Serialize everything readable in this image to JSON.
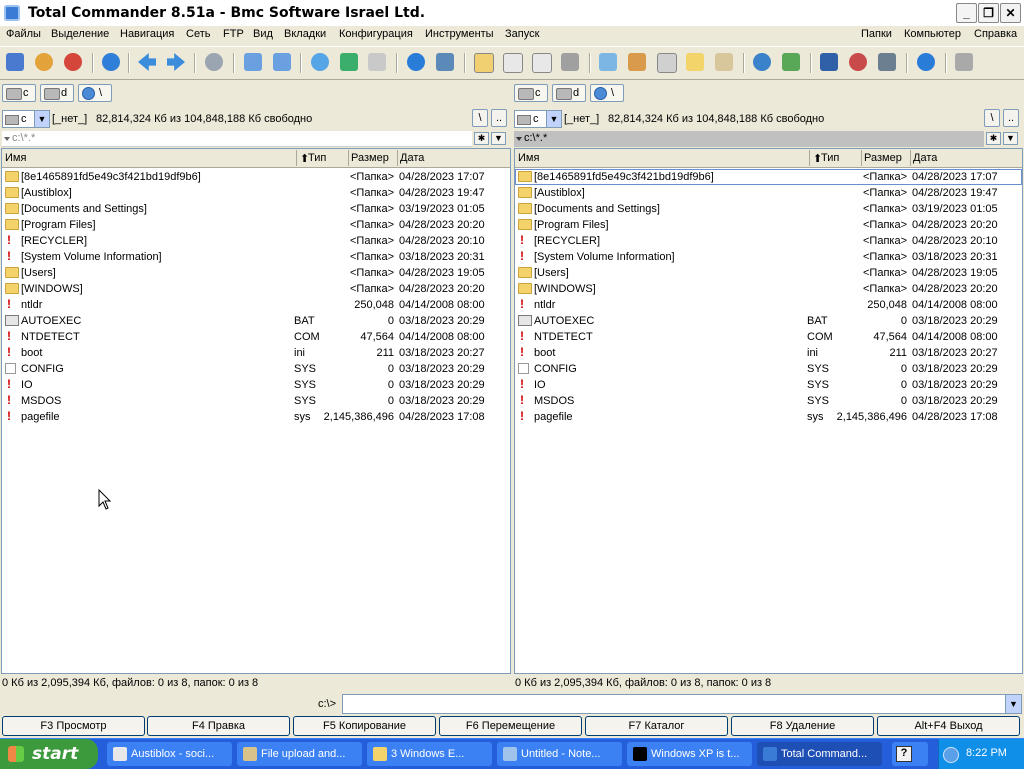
{
  "window": {
    "title": "Total Commander 8.51a - Bmc Software Israel Ltd."
  },
  "menu": {
    "left": [
      "Файлы",
      "Выделение",
      "Навигация",
      "Сеть",
      "FTP",
      "Вид",
      "Вкладки",
      "Конфигурация",
      "Инструменты",
      "Запуск"
    ],
    "right": [
      "Папки",
      "Компьютер",
      "Справка"
    ]
  },
  "drives": [
    {
      "label": "c"
    },
    {
      "label": "d"
    },
    {
      "label": "\\"
    }
  ],
  "left_panel": {
    "drive_combo": "c",
    "volume": "[_нет_]",
    "free": "82,814,324 Кб из 104,848,188 Кб свободно",
    "btn_root": "\\",
    "btn_up": "..",
    "path": "c:\\*.*",
    "headers": {
      "name": "Имя",
      "ext": "Тип",
      "size": "Размер",
      "date": "Дата"
    },
    "status": "0 Кб из 2,095,394 Кб, файлов: 0 из 8, папок: 0 из 8"
  },
  "right_panel": {
    "drive_combo": "c",
    "volume": "[_нет_]",
    "free": "82,814,324 Кб из 104,848,188 Кб свободно",
    "btn_root": "\\",
    "btn_up": "..",
    "path": "c:\\*.*",
    "headers": {
      "name": "Имя",
      "ext": "Тип",
      "size": "Размер",
      "date": "Дата"
    },
    "status": "0 Кб из 2,095,394 Кб, файлов: 0 из 8, папок: 0 из 8"
  },
  "files": [
    {
      "icon": "folder",
      "name": "[8e1465891fd5e49c3f421bd19df9b6]",
      "ext": "",
      "size": "<Папка>",
      "date": "04/28/2023 17:07"
    },
    {
      "icon": "folder",
      "name": "[Austiblox]",
      "ext": "",
      "size": "<Папка>",
      "date": "04/28/2023 19:47"
    },
    {
      "icon": "folder",
      "name": "[Documents and Settings]",
      "ext": "",
      "size": "<Папка>",
      "date": "03/19/2023 01:05"
    },
    {
      "icon": "folder",
      "name": "[Program Files]",
      "ext": "",
      "size": "<Папка>",
      "date": "04/28/2023 20:20"
    },
    {
      "icon": "hidden",
      "name": "[RECYCLER]",
      "ext": "",
      "size": "<Папка>",
      "date": "04/28/2023 20:10"
    },
    {
      "icon": "hidden",
      "name": "[System Volume Information]",
      "ext": "",
      "size": "<Папка>",
      "date": "03/18/2023 20:31"
    },
    {
      "icon": "folder",
      "name": "[Users]",
      "ext": "",
      "size": "<Папка>",
      "date": "04/28/2023 19:05"
    },
    {
      "icon": "folder",
      "name": "[WINDOWS]",
      "ext": "",
      "size": "<Папка>",
      "date": "04/28/2023 20:20"
    },
    {
      "icon": "hidden",
      "name": "ntldr",
      "ext": "",
      "size": "250,048",
      "date": "04/14/2008 08:00"
    },
    {
      "icon": "exe",
      "name": "AUTOEXEC",
      "ext": "BAT",
      "size": "0",
      "date": "03/18/2023 20:29"
    },
    {
      "icon": "hidden",
      "name": "NTDETECT",
      "ext": "COM",
      "size": "47,564",
      "date": "04/14/2008 08:00"
    },
    {
      "icon": "hidden",
      "name": "boot",
      "ext": "ini",
      "size": "211",
      "date": "03/18/2023 20:27"
    },
    {
      "icon": "file",
      "name": "CONFIG",
      "ext": "SYS",
      "size": "0",
      "date": "03/18/2023 20:29"
    },
    {
      "icon": "hidden",
      "name": "IO",
      "ext": "SYS",
      "size": "0",
      "date": "03/18/2023 20:29"
    },
    {
      "icon": "hidden",
      "name": "MSDOS",
      "ext": "SYS",
      "size": "0",
      "date": "03/18/2023 20:29"
    },
    {
      "icon": "hidden",
      "name": "pagefile",
      "ext": "sys",
      "size": "2,145,386,496",
      "date": "04/28/2023 17:08"
    }
  ],
  "cmdline": {
    "label": "c:\\>",
    "value": ""
  },
  "fkeys": [
    "F3 Просмотр",
    "F4 Правка",
    "F5 Копирование",
    "F6 Перемещение",
    "F7 Каталог",
    "F8 Удаление",
    "Alt+F4 Выход"
  ],
  "taskbar": {
    "start": "start",
    "tasks": [
      "Austiblox - soci...",
      "File upload and...",
      "3 Windows E...",
      "Untitled - Note...",
      "Windows XP is t...",
      "Total Command..."
    ],
    "clock": "8:22 PM"
  },
  "colors": {
    "accent": "#245edb",
    "folder": "#f5d36b",
    "hidden": "#d00000",
    "selection": "#c0c0c0"
  }
}
